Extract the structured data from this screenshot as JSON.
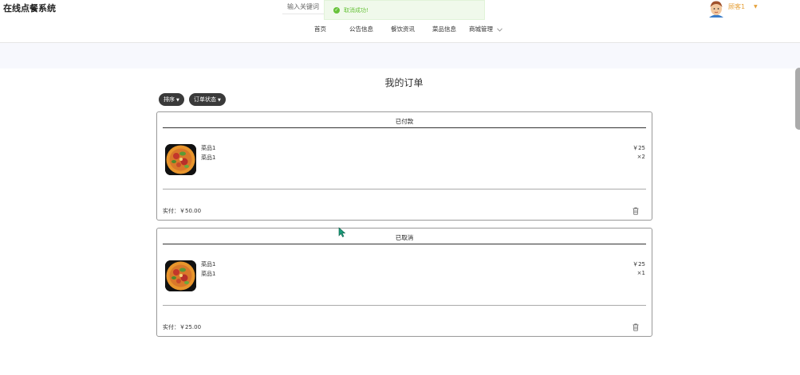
{
  "header": {
    "site_title": "在线点餐系统",
    "search_placeholder": "输入关键词",
    "toast_message": "取消成功!",
    "nav": [
      "首页",
      "公告信息",
      "餐饮资讯",
      "菜品信息",
      "商城管理"
    ],
    "user_name": "顾客1"
  },
  "page": {
    "title": "我的订单",
    "sort_label": "排序",
    "status_filter_label": "订单状态"
  },
  "orders": [
    {
      "status": "已付款",
      "item_name": "菜品1",
      "item_subname": "菜品1",
      "price": "￥25",
      "quantity": "×2",
      "total_label": "实付：",
      "total": "￥50.00"
    },
    {
      "status": "已取消",
      "item_name": "菜品1",
      "item_subname": "菜品1",
      "price": "￥25",
      "quantity": "×1",
      "total_label": "实付：",
      "total": "￥25.00"
    }
  ],
  "colors": {
    "accent_orange": "#e6a23c",
    "success_green": "#67c23a",
    "band_bg": "#f7f8fd",
    "dark_button": "#3a3a3a"
  },
  "icons": [
    "check-circle-icon",
    "chevron-down-icon",
    "caret-down-icon",
    "trash-icon",
    "dish-image",
    "avatar"
  ]
}
